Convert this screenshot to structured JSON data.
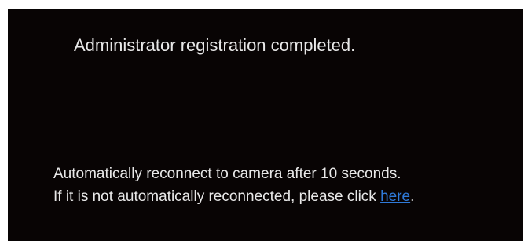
{
  "dialog": {
    "title": "Administrator registration completed.",
    "line1": "Automatically reconnect to camera after 10 seconds.",
    "line2_prefix": "If it is not automatically reconnected, please click ",
    "link_label": "here",
    "line2_suffix": "."
  },
  "colors": {
    "background": "#080404",
    "text": "#e8e8e8",
    "link": "#2f7ad9"
  }
}
